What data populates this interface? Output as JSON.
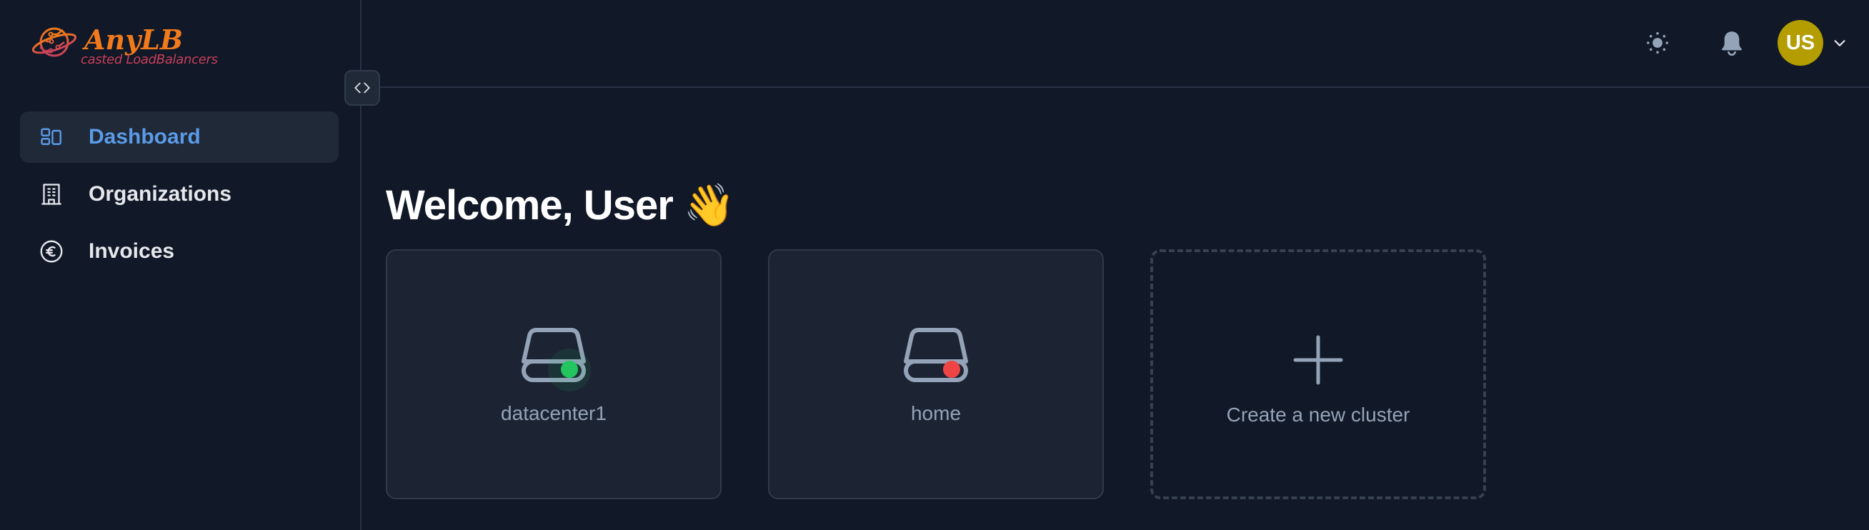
{
  "app": {
    "name": "AnyLB",
    "tagline": "casted LoadBalancers",
    "brand_colors": {
      "title": "#f07a1c",
      "tagline": "#c8405a"
    }
  },
  "sidebar": {
    "toggle_icon": "code-brackets-icon",
    "items": [
      {
        "label": "Dashboard",
        "icon": "dashboard-icon",
        "active": true
      },
      {
        "label": "Organizations",
        "icon": "building-icon",
        "active": false
      },
      {
        "label": "Invoices",
        "icon": "currency-euro-icon",
        "active": false
      }
    ]
  },
  "header": {
    "theme_icon": "sun-icon",
    "notifications_icon": "bell-icon",
    "user": {
      "initials": "US",
      "avatar_color": "#b39d00"
    },
    "menu_icon": "chevron-down-icon"
  },
  "main": {
    "welcome": "Welcome, User 👋",
    "clusters": [
      {
        "name": "datacenter1",
        "status": "online",
        "status_color": "#22c55e"
      },
      {
        "name": "home",
        "status": "offline",
        "status_color": "#ef4444"
      }
    ],
    "create_cluster": {
      "label": "Create a new cluster",
      "icon": "plus-icon"
    }
  }
}
